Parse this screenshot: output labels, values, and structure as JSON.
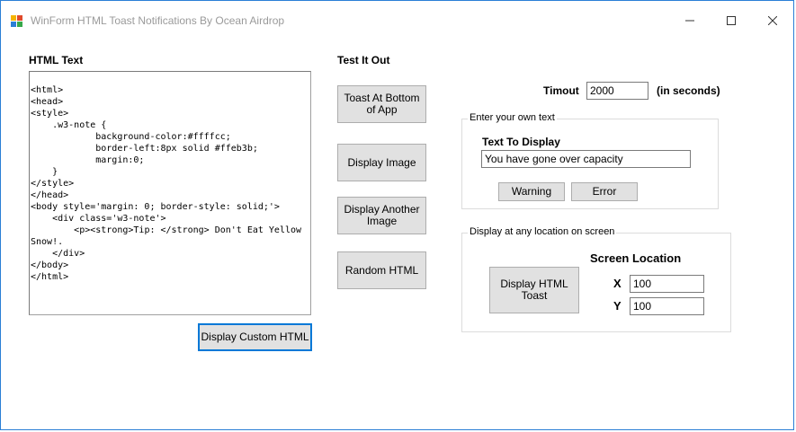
{
  "window": {
    "title": "WinForm HTML Toast Notifications By Ocean Airdrop"
  },
  "left": {
    "heading": "HTML Text",
    "html_text": "<html>\n<head>\n<style>\n    .w3-note {\n            background-color:#ffffcc;\n            border-left:8px solid #ffeb3b;\n            margin:0;\n    }\n</style>\n</head>\n<body style='margin: 0; border-style: solid;'>\n    <div class='w3-note'>\n        <p><strong>Tip: </strong> Don't Eat Yellow Snow!.\n    </div>\n</body>\n</html>",
    "display_custom_button": "Display Custom HTML"
  },
  "middle": {
    "heading": "Test It Out",
    "buttons": [
      "Toast At Bottom of App",
      "Display Image",
      "Display Another Image",
      "Random HTML"
    ]
  },
  "right": {
    "timeout_label": "Timout",
    "timeout_value": "2000",
    "timeout_unit": "(in seconds)",
    "own_text_group": {
      "legend": "Enter your own text",
      "label": "Text To Display",
      "value": "You have gone over capacity",
      "warning_button": "Warning",
      "error_button": "Error"
    },
    "location_group": {
      "legend": "Display at any location on screen",
      "heading": "Screen Location",
      "display_button": "Display HTML Toast",
      "x_label": "X",
      "x_value": "100",
      "y_label": "Y",
      "y_value": "100"
    }
  }
}
